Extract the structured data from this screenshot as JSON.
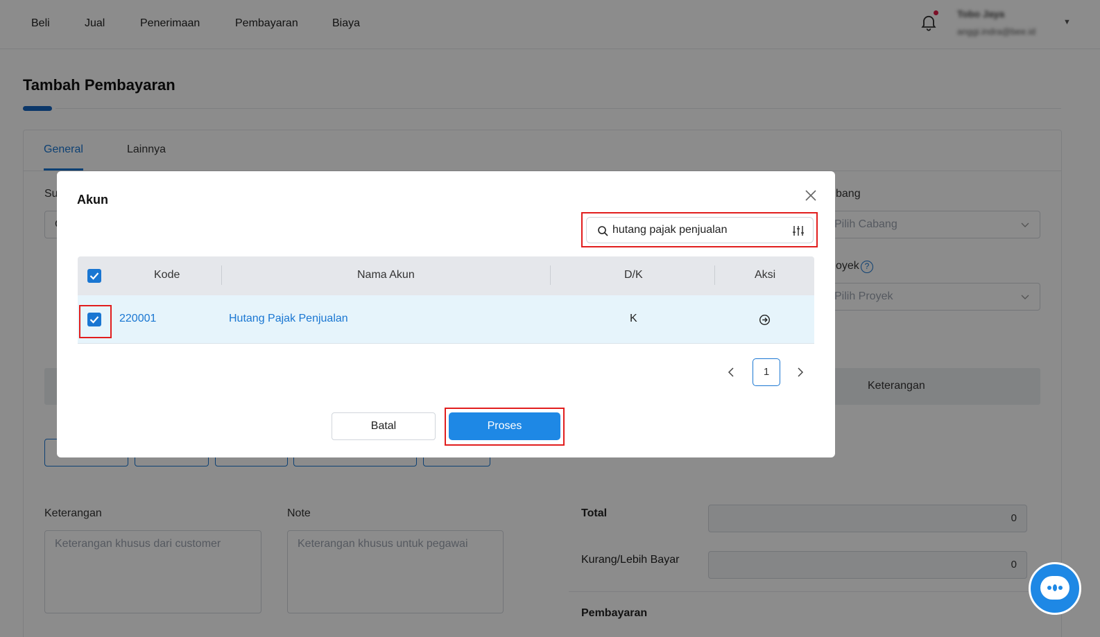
{
  "nav": {
    "items": [
      "Beli",
      "Jual",
      "Penerimaan",
      "Pembayaran",
      "Biaya"
    ],
    "user_name": "Tobo Jaya",
    "user_email": "anggi.indra@bee.id"
  },
  "page": {
    "title": "Tambah Pembayaran",
    "tabs": [
      "General",
      "Lainnya"
    ],
    "field_label_supplier": "Su",
    "supplier_value_partial": "C",
    "cabang_label": "bang",
    "cabang_placeholder": "Pilih Cabang",
    "proyek_label": "oyek",
    "proyek_placeholder": "Pilih Proyek",
    "table_header_keterangan": "Keterangan",
    "keterangan_label": "Keterangan",
    "keterangan_placeholder": "Keterangan khusus dari customer",
    "note_label": "Note",
    "note_placeholder": "Keterangan khusus untuk pegawai",
    "total_label": "Total",
    "total_value": "0",
    "kurang_label": "Kurang/Lebih Bayar",
    "kurang_value": "0",
    "pembayaran_label": "Pembayaran"
  },
  "modal": {
    "title": "Akun",
    "search_value": "hutang pajak penjualan",
    "columns": [
      "Kode",
      "Nama Akun",
      "D/K",
      "Aksi"
    ],
    "rows": [
      {
        "kode": "220001",
        "nama_akun": "Hutang Pajak Penjualan",
        "dk": "K",
        "checked": true
      }
    ],
    "pagination": {
      "current_page": "1"
    },
    "cancel_label": "Batal",
    "process_label": "Proses"
  },
  "colors": {
    "primary": "#1976d2",
    "proses_button": "#1e88e5",
    "highlight_box": "#e11d1d",
    "row_selected": "#e6f4fb"
  },
  "icons": [
    "bell-icon",
    "chevron-down-icon",
    "help-icon",
    "close-icon",
    "search-icon",
    "filter-icon",
    "arrow-right-circle-icon",
    "chevron-left-icon",
    "chevron-right-icon",
    "check-icon",
    "chat-icon"
  ]
}
